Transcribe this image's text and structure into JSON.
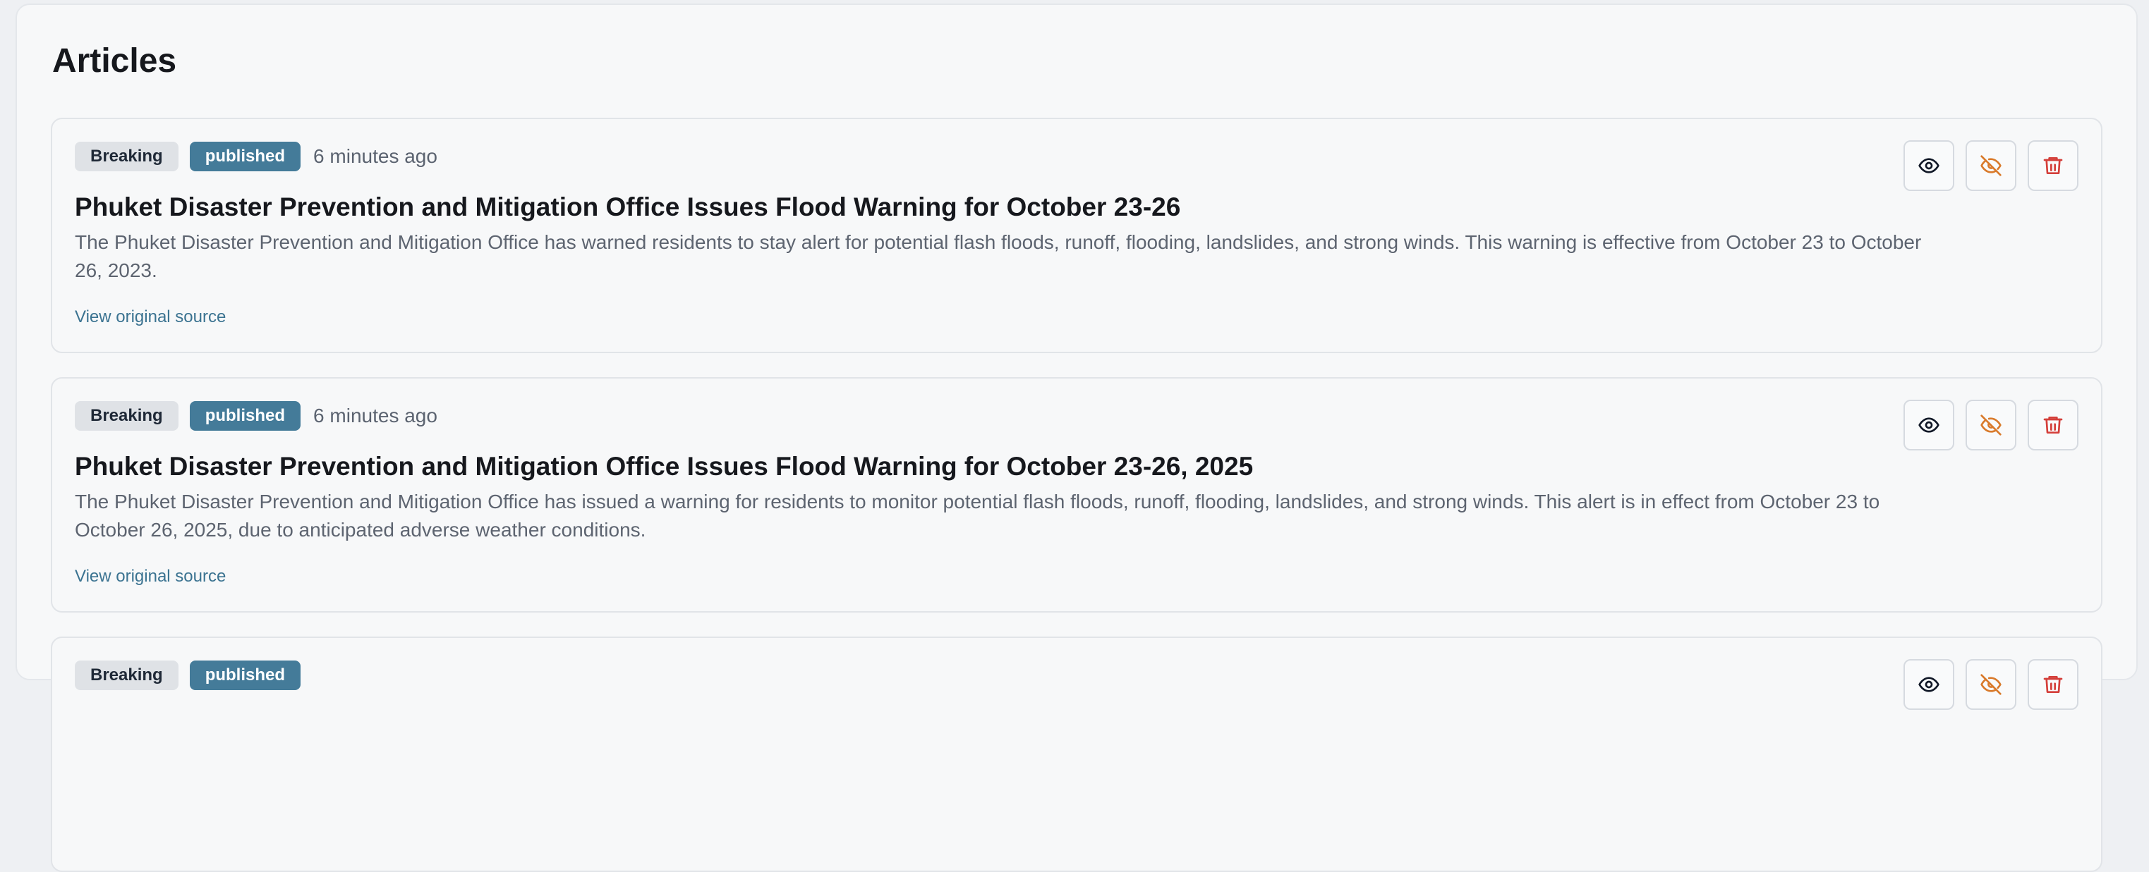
{
  "page": {
    "title": "Articles"
  },
  "articles": [
    {
      "category": "Breaking",
      "status": "published",
      "time": "6 minutes ago",
      "title": "Phuket Disaster Prevention and Mitigation Office Issues Flood Warning for October 23-26",
      "summary": "The Phuket Disaster Prevention and Mitigation Office has warned residents to stay alert for potential flash floods, runoff, flooding, landslides, and strong winds. This warning is effective from October 23 to October 26, 2023.",
      "link_label": "View original source"
    },
    {
      "category": "Breaking",
      "status": "published",
      "time": "6 minutes ago",
      "title": "Phuket Disaster Prevention and Mitigation Office Issues Flood Warning for October 23-26, 2025",
      "summary": "The Phuket Disaster Prevention and Mitigation Office has issued a warning for residents to monitor potential flash floods, runoff, flooding, landslides, and strong winds. This alert is in effect from October 23 to October 26, 2025, due to anticipated adverse weather conditions.",
      "link_label": "View original source"
    },
    {
      "category": "Breaking",
      "status": "published"
    }
  ],
  "actions": {
    "view_icon": "eye-icon",
    "hide_icon": "eye-off-icon",
    "delete_icon": "trash-icon"
  },
  "colors": {
    "status_badge": "#447b99",
    "link": "#3b7391",
    "hide_icon": "#d97a2b",
    "delete_icon": "#d43f3a"
  }
}
